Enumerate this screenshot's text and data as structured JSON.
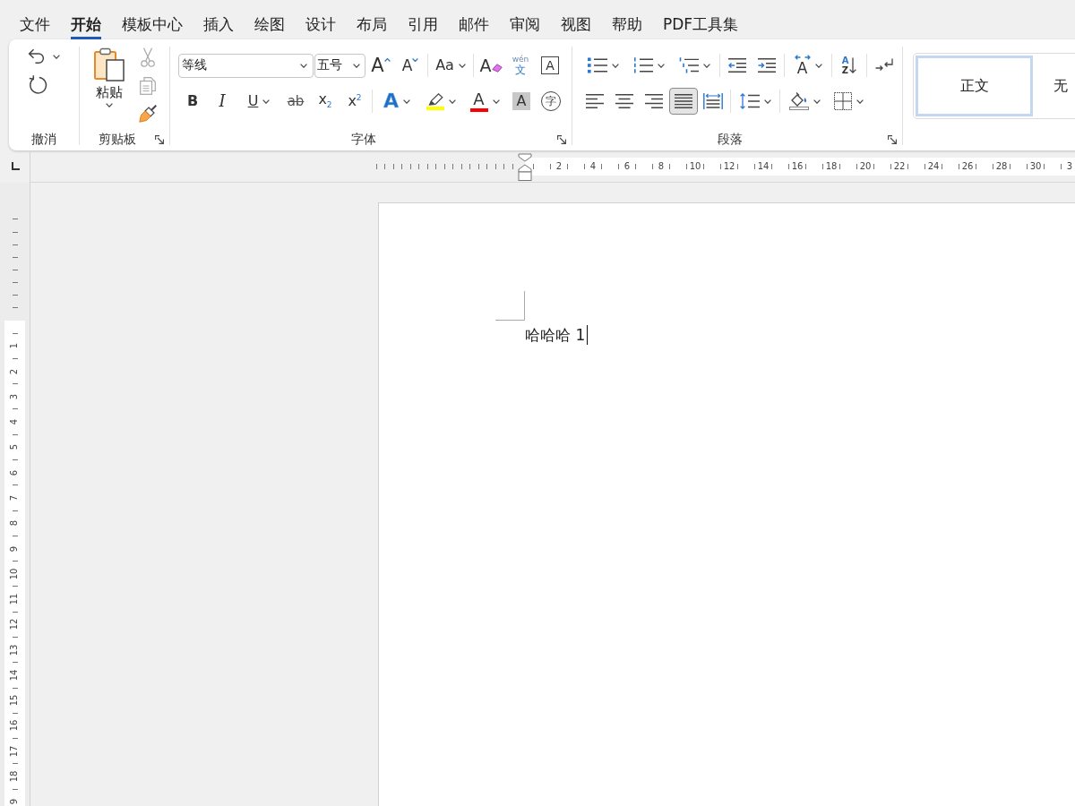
{
  "menu_tabs": [
    {
      "label": "文件",
      "selected": false
    },
    {
      "label": "开始",
      "selected": true
    },
    {
      "label": "模板中心",
      "selected": false
    },
    {
      "label": "插入",
      "selected": false
    },
    {
      "label": "绘图",
      "selected": false
    },
    {
      "label": "设计",
      "selected": false
    },
    {
      "label": "布局",
      "selected": false
    },
    {
      "label": "引用",
      "selected": false
    },
    {
      "label": "邮件",
      "selected": false
    },
    {
      "label": "审阅",
      "selected": false
    },
    {
      "label": "视图",
      "selected": false
    },
    {
      "label": "帮助",
      "selected": false
    },
    {
      "label": "PDF工具集",
      "selected": false
    }
  ],
  "ribbon": {
    "groups": [
      {
        "kind": "stack",
        "label": "撤消",
        "items": [
          {
            "kind": "undo",
            "dropdown": true
          },
          {
            "kind": "redo"
          }
        ]
      },
      {
        "kind": "clipboard",
        "label": "剪贴板",
        "launcher": true,
        "items": [
          {
            "kind": "paste",
            "label": "粘贴",
            "dropdown": true
          },
          {
            "kind": "cut",
            "disabled": true
          },
          {
            "kind": "copy",
            "disabled": true
          },
          {
            "kind": "painter",
            "disabled": false
          }
        ]
      },
      {
        "kind": "toolbar",
        "label": "字体",
        "launcher": true,
        "upper": [
          {
            "kind": "fontname",
            "value": "等线"
          },
          {
            "kind": "fontsize",
            "value": "五号"
          },
          {
            "kind": "grow",
            "glyph": "A"
          },
          {
            "kind": "shrink",
            "glyph": "A"
          },
          {
            "kind": "separator"
          },
          {
            "kind": "case",
            "glyph": "Aa",
            "dropdown": true
          },
          {
            "kind": "separator"
          },
          {
            "kind": "clear",
            "glyph": "A"
          },
          {
            "kind": "phonetic",
            "glyph": "wén",
            "sub_glyph": "文"
          },
          {
            "kind": "border",
            "glyph": "A"
          }
        ],
        "lower": [
          {
            "kind": "bold",
            "glyph": "B"
          },
          {
            "kind": "italic",
            "glyph": "I"
          },
          {
            "kind": "underline",
            "glyph": "U",
            "dropdown": true
          },
          {
            "kind": "strike",
            "glyph": "ab"
          },
          {
            "kind": "subscript",
            "glyph": "x$_{2}$"
          },
          {
            "kind": "superscript",
            "glyph": "x$^{2}$"
          },
          {
            "kind": "separator"
          },
          {
            "kind": "effects",
            "glyph": "A",
            "dropdown": true
          },
          {
            "kind": "highlight",
            "color": "#ffff00",
            "dropdown": true
          },
          {
            "kind": "fontcolor",
            "glyph": "A",
            "color": "#ff0000",
            "dropdown": true
          },
          {
            "kind": "shading",
            "glyph": "A"
          },
          {
            "kind": "enclose",
            "glyph": "字"
          }
        ]
      },
      {
        "kind": "toolbar",
        "label": "段落",
        "launcher": true,
        "upper": [
          {
            "kind": "bullets",
            "dropdown": true
          },
          {
            "kind": "numbering",
            "dropdown": true
          },
          {
            "kind": "multilevel",
            "dropdown": true
          },
          {
            "kind": "separator"
          },
          {
            "kind": "outdent"
          },
          {
            "kind": "indent"
          },
          {
            "kind": "separator"
          },
          {
            "kind": "layout",
            "glyph": "A",
            "dropdown": true
          },
          {
            "kind": "separator"
          },
          {
            "kind": "sort",
            "glyph": "A",
            "sub_glyph": "Z"
          },
          {
            "kind": "separator"
          },
          {
            "kind": "marks"
          }
        ],
        "lower": [
          {
            "kind": "alignleft",
            "selected": false
          },
          {
            "kind": "aligncenter",
            "selected": false
          },
          {
            "kind": "alignright",
            "selected": false
          },
          {
            "kind": "justify",
            "selected": true
          },
          {
            "kind": "distribute",
            "selected": false
          },
          {
            "kind": "separator"
          },
          {
            "kind": "spacing",
            "dropdown": true
          },
          {
            "kind": "separator"
          },
          {
            "kind": "fill",
            "dropdown": true
          },
          {
            "kind": "borders",
            "dropdown": true
          }
        ]
      },
      {
        "kind": "gallery",
        "items": [
          {
            "label": "正文",
            "selected": true
          },
          {
            "label": "无",
            "selected": false
          }
        ]
      }
    ]
  },
  "rulers": {
    "horizontal": [
      "2",
      "4",
      "6",
      "8",
      "10",
      "12",
      "14",
      "16",
      "18",
      "20",
      "22",
      "24",
      "26",
      "28",
      "30",
      "3"
    ],
    "vertical": [
      "1",
      "2",
      "3",
      "4",
      "5",
      "6",
      "7",
      "8",
      "9",
      "10",
      "11",
      "12",
      "13",
      "14",
      "15",
      "16",
      "17",
      "18",
      "9"
    ]
  },
  "document": {
    "text": "哈哈哈 1"
  }
}
